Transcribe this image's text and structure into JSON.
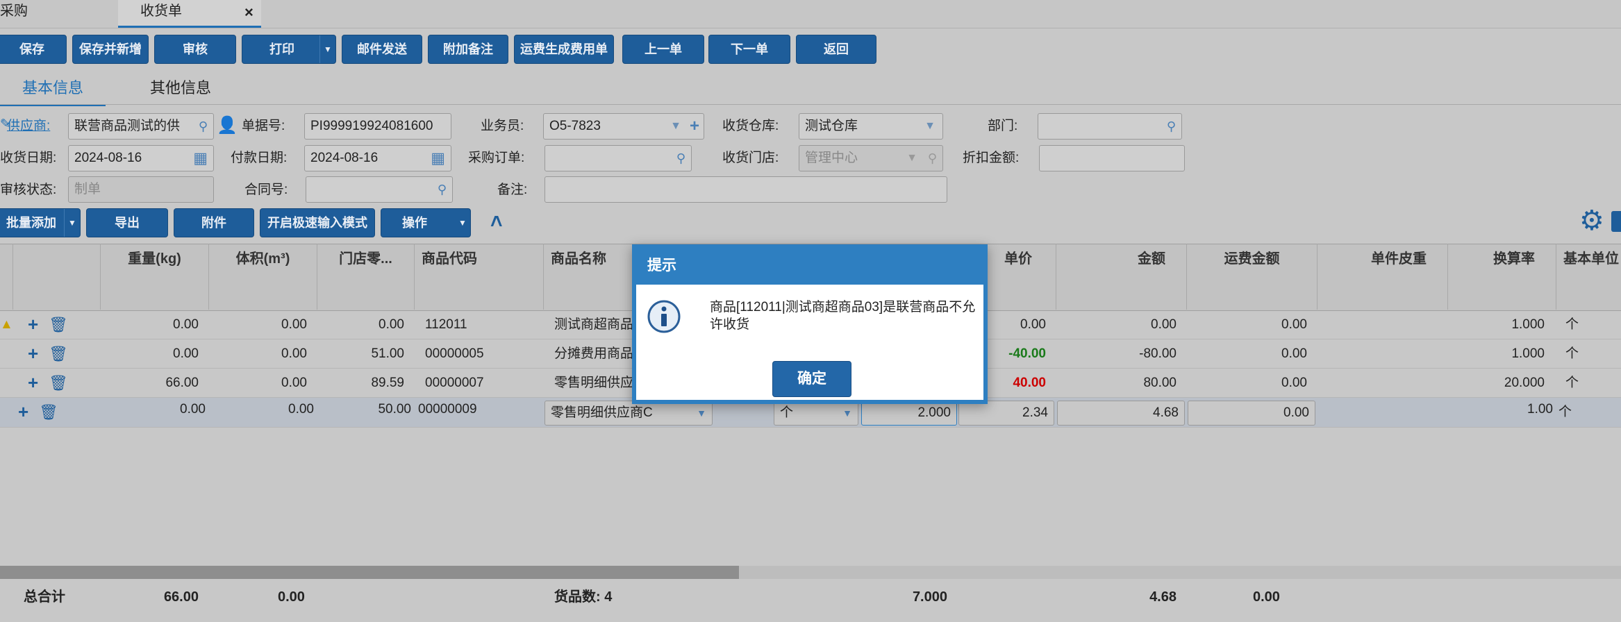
{
  "top_tabs": [
    {
      "label": "采购"
    },
    {
      "label": "收货单",
      "active": true,
      "close": "×"
    }
  ],
  "toolbar": {
    "save": "保存",
    "save_new": "保存并新增",
    "audit": "审核",
    "print": "打印",
    "email": "邮件发送",
    "attach_note": "附加备注",
    "freight_fee": "运费生成费用单",
    "prev": "上一单",
    "next": "下一单",
    "back": "返回"
  },
  "info_tabs": [
    "基本信息",
    "其他信息"
  ],
  "form": {
    "supplier_label": "供应商:",
    "supplier_value": "联营商品测试的供",
    "doc_no_label": "单据号:",
    "doc_no_value": "PI999919924081600",
    "salesman_label": "业务员:",
    "salesman_value": "O5-7823",
    "warehouse_label": "收货仓库:",
    "warehouse_value": "测试仓库",
    "dept_label": "部门:",
    "dept_value": "",
    "recv_date_label": "收货日期:",
    "recv_date_value": "2024-08-16",
    "pay_date_label": "付款日期:",
    "pay_date_value": "2024-08-16",
    "po_label": "采购订单:",
    "po_value": "",
    "store_label": "收货门店:",
    "store_value": "管理中心",
    "discount_label": "折扣金额:",
    "discount_value": "",
    "audit_status_label": "审核状态:",
    "audit_status_value": "制单",
    "contract_label": "合同号:",
    "contract_value": "",
    "remark_label": "备注:",
    "remark_value": ""
  },
  "grid_toolbar": {
    "batch_add": "批量添加",
    "export": "导出",
    "attachment": "附件",
    "fast_input": "开启极速输入模式",
    "operate": "操作"
  },
  "columns": [
    "重量(kg)",
    "体积(m³)",
    "门店零...",
    "商品代码",
    "商品名称",
    "单价",
    "金额",
    "运费金额",
    "单件皮重",
    "换算率",
    "基本单位"
  ],
  "rows": [
    {
      "weight": "0.00",
      "volume": "0.00",
      "store_retail": "0.00",
      "code": "112011",
      "name": "测试商超商品",
      "price": "0.00",
      "amount": "0.00",
      "freight": "0.00",
      "rate": "1.000",
      "unit": "个"
    },
    {
      "weight": "0.00",
      "volume": "0.00",
      "store_retail": "51.00",
      "code": "00000005",
      "name": "分摊费用商品",
      "price": "-40.00",
      "amount": "-80.00",
      "freight": "0.00",
      "rate": "1.000",
      "unit": "个"
    },
    {
      "weight": "66.00",
      "volume": "0.00",
      "store_retail": "89.59",
      "code": "00000007",
      "name": "零售明细供应",
      "price": "40.00",
      "amount": "80.00",
      "freight": "0.00",
      "rate": "20.000",
      "unit": "个"
    }
  ],
  "edit_row": {
    "weight": "0.00",
    "volume": "0.00",
    "store_retail": "50.00",
    "code": "00000009",
    "supplier": "零售明细供应商C",
    "unit_select": "个",
    "qty": "2.000",
    "price": "2.34",
    "amount": "4.68",
    "freight": "0.00",
    "rate": "1.00",
    "unit": "个"
  },
  "totals": {
    "label": "总合计",
    "weight": "66.00",
    "volume": "0.00",
    "goods_count": "货品数: 4",
    "qty": "7.000",
    "amount": "4.68",
    "freight": "0.00"
  },
  "modal": {
    "title": "提示",
    "message": "商品[112011|测试商超商品03]是联营商品不允许收货",
    "ok": "确定"
  },
  "colors": {
    "primary": "#1e5d9a",
    "modal_header": "#2e7fc1",
    "negative": "#c00000",
    "positive_green": "#1a7a1a"
  }
}
